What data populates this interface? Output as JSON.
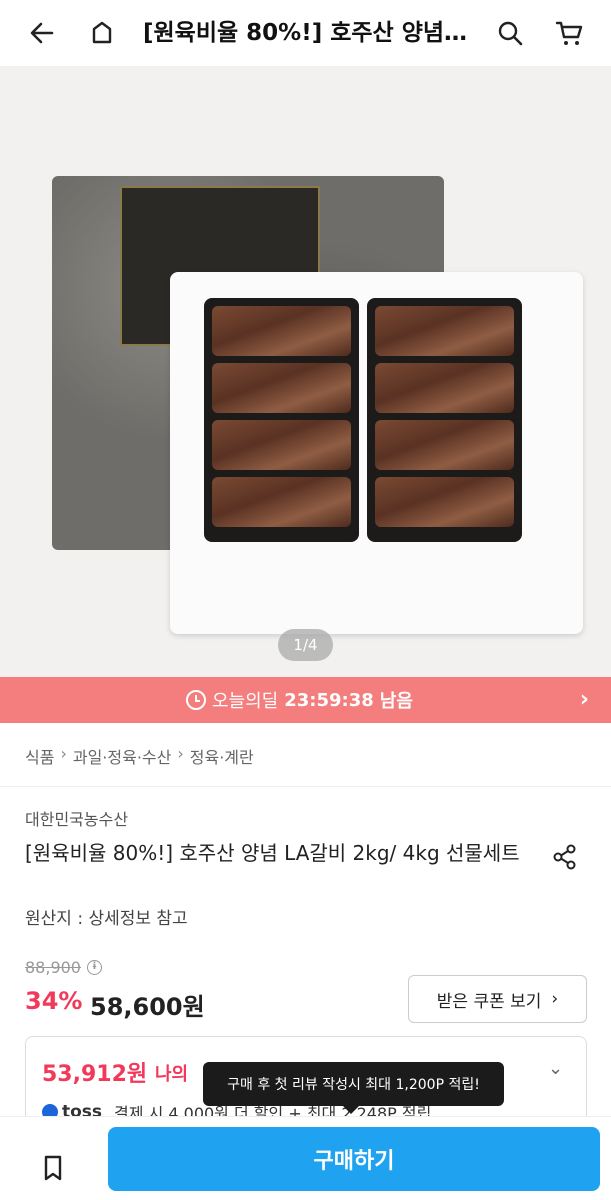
{
  "header": {
    "title": "[원육비율 80%!] 호주산 양념 LA갈비 2kg/ 4kg 선물세트",
    "icons": [
      "arrow-left-icon",
      "home-icon",
      "search-icon",
      "cart-icon"
    ]
  },
  "gallery": {
    "counter": "1/4"
  },
  "deal": {
    "label": "오늘의딜",
    "time": "23:59:38",
    "suffix": "남음",
    "color": "#f47e7e"
  },
  "breadcrumb": [
    "식품",
    "과일·정육·수산",
    "정육·계란"
  ],
  "product": {
    "brand": "대한민국농수산",
    "name": "[원육비율 80%!] 호주산 양념 LA갈비 2kg/ 4kg 선물세트",
    "origin": "원산지 : 상세정보 참고",
    "original_price": "88,900",
    "discount": "34%",
    "price": "58,600원"
  },
  "coupon": {
    "label": "받은 쿠폰 보기"
  },
  "benefit": {
    "price": "53,912원",
    "label": "나의 할인가",
    "toss_name": "toss",
    "toss_text": "결제 시 4,000원 더 할인 + 최대 2,248P 적립"
  },
  "tooltip": {
    "text": "구매 후 첫 리뷰 작성시 최대 1,200P 적립!"
  },
  "bottom": {
    "buy_label": "구매하기"
  },
  "colors": {
    "accent": "#1fa3f0",
    "sale": "#f2395a"
  }
}
